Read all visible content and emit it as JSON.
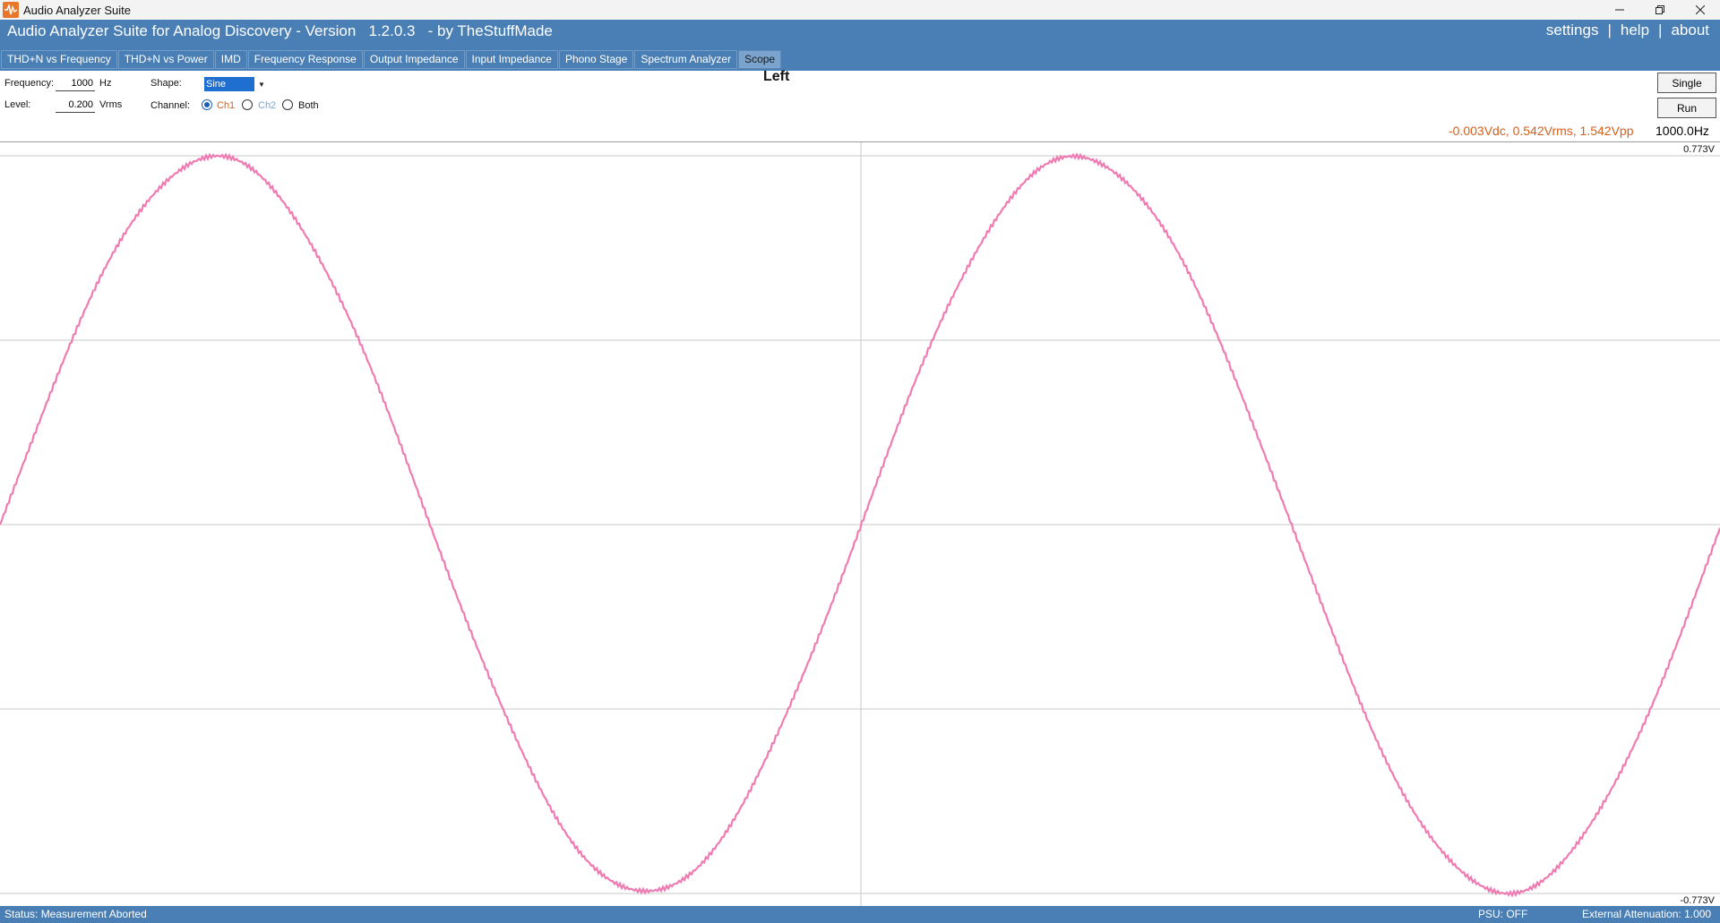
{
  "window": {
    "title": "Audio Analyzer Suite",
    "controls": [
      "minimize-icon",
      "restore-icon",
      "close-icon"
    ]
  },
  "header": {
    "app_title": "Audio Analyzer Suite for Analog Discovery - Version   1.2.0.3   - by TheStuffMade",
    "links": {
      "settings": "settings",
      "separator": "|",
      "help": "help",
      "about": "about"
    },
    "accent_color": "#4a7fb5"
  },
  "tabs": [
    {
      "label": "THD+N vs Frequency",
      "active": false
    },
    {
      "label": "THD+N vs Power",
      "active": false
    },
    {
      "label": "IMD",
      "active": false
    },
    {
      "label": "Frequency Response",
      "active": false
    },
    {
      "label": "Output Impedance",
      "active": false
    },
    {
      "label": "Input Impedance",
      "active": false
    },
    {
      "label": "Phono Stage",
      "active": false
    },
    {
      "label": "Spectrum Analyzer",
      "active": false
    },
    {
      "label": "Scope",
      "active": true
    }
  ],
  "controls": {
    "frequency": {
      "label": "Frequency:",
      "value": "1000",
      "unit": "Hz"
    },
    "level": {
      "label": "Level:",
      "value": "0.200",
      "unit": "Vrms"
    },
    "shape": {
      "label": "Shape:",
      "value": "Sine"
    },
    "channel": {
      "label": "Channel:",
      "options": [
        {
          "label": "Ch1",
          "selected": true,
          "color": "#d2611f"
        },
        {
          "label": "Ch2",
          "selected": false,
          "color": "#7aa3cd"
        },
        {
          "label": "Both",
          "selected": false,
          "color": "#111111"
        }
      ]
    },
    "single_button": "Single",
    "run_button": "Run"
  },
  "scope": {
    "channel_title": "Left",
    "measurement": "-0.003Vdc, 0.542Vrms, 1.542Vpp",
    "frequency_readout": "1000.0Hz",
    "y_max_label": "0.773V",
    "y_min_label": "-0.773V",
    "trace_color": "#f07ab2",
    "grid_color": "#c8c8c8",
    "signal": {
      "amplitude_v": 0.771,
      "frequency_hz": 1000,
      "cycles_shown": 2,
      "y_range": [
        -0.773,
        0.773
      ]
    }
  },
  "status": {
    "text": "Status: Measurement Aborted",
    "psu": "PSU: OFF",
    "attenuation": "External Attenuation: 1.000"
  }
}
